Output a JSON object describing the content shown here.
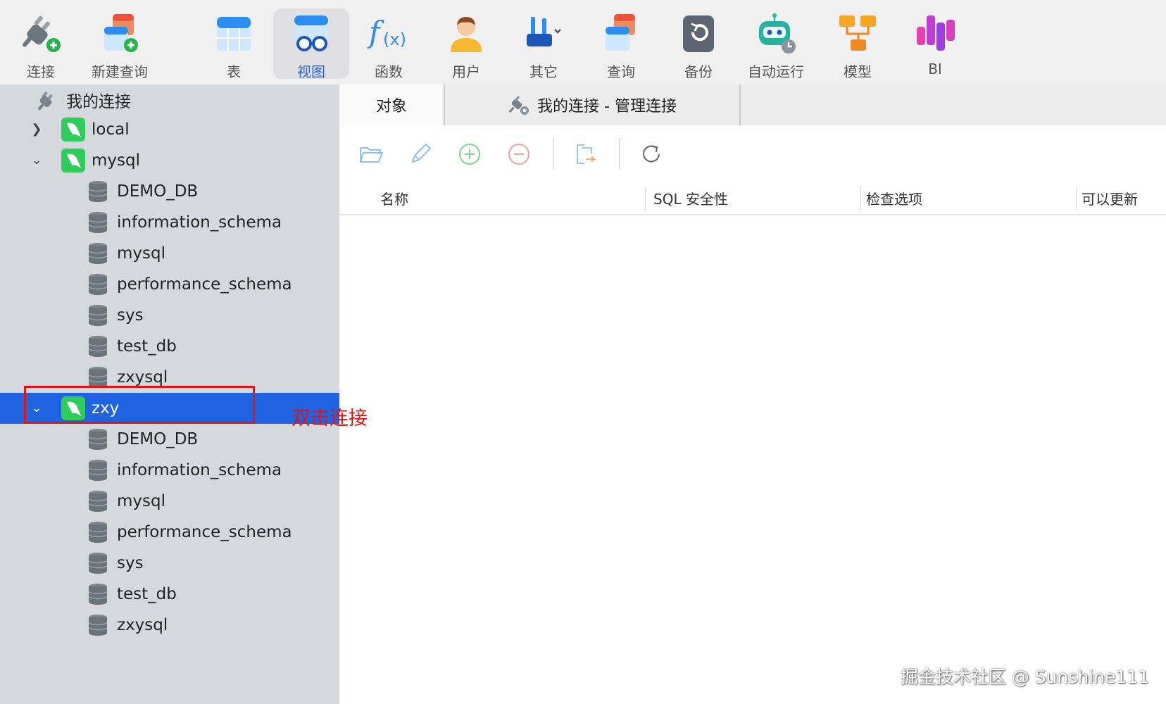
{
  "toolbar": {
    "items": [
      {
        "label": "连接",
        "icon": "connect-plug-icon"
      },
      {
        "label": "新建查询",
        "icon": "new-query-icon"
      },
      {
        "label": "表",
        "icon": "table-icon"
      },
      {
        "label": "视图",
        "icon": "view-glasses-icon",
        "active": true
      },
      {
        "label": "函数",
        "icon": "function-fx-icon"
      },
      {
        "label": "用户",
        "icon": "user-icon"
      },
      {
        "label": "其它",
        "icon": "tools-icon"
      },
      {
        "label": "查询",
        "icon": "query-icon"
      },
      {
        "label": "备份",
        "icon": "backup-icon"
      },
      {
        "label": "自动运行",
        "icon": "robot-icon"
      },
      {
        "label": "模型",
        "icon": "model-icon"
      },
      {
        "label": "BI",
        "icon": "bi-chart-icon"
      }
    ]
  },
  "sidebar": {
    "root": "我的连接",
    "connections": [
      {
        "name": "local",
        "expanded": false,
        "databases": []
      },
      {
        "name": "mysql",
        "expanded": true,
        "databases": [
          "DEMO_DB",
          "information_schema",
          "mysql",
          "performance_schema",
          "sys",
          "test_db",
          "zxysql"
        ]
      },
      {
        "name": "zxy",
        "expanded": true,
        "selected": true,
        "databases": [
          "DEMO_DB",
          "information_schema",
          "mysql",
          "performance_schema",
          "sys",
          "test_db",
          "zxysql"
        ]
      }
    ]
  },
  "annotation": {
    "text": "双击连接"
  },
  "tabs": {
    "objects": "对象",
    "manage": "我的连接 - 管理连接"
  },
  "object_toolbar": {
    "icons": [
      "open-folder-icon",
      "edit-pencil-icon",
      "add-circle-icon",
      "remove-circle-icon",
      "export-icon",
      "refresh-icon"
    ]
  },
  "columns": [
    "名称",
    "SQL 安全性",
    "检查选项",
    "可以更新"
  ],
  "watermark": "掘金技术社区 @ Sunshine111",
  "colors": {
    "selection": "#1f63e0",
    "annotation": "#e01515",
    "active_label": "#2a62d8",
    "connection_icon": "#2ecc5a"
  }
}
